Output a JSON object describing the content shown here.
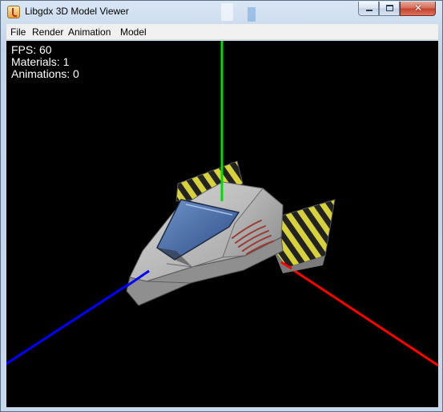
{
  "window": {
    "title": "Libgdx 3D Model Viewer",
    "controls": {
      "minimize": "minimize",
      "maximize": "maximize",
      "close": "✕"
    }
  },
  "menubar": {
    "items": [
      {
        "label": "File"
      },
      {
        "label": "Render"
      },
      {
        "label": "Animation"
      },
      {
        "label": "Model"
      }
    ]
  },
  "viewport": {
    "background": "#000000",
    "hud": {
      "fps": "FPS: 60",
      "materials": "Materials: 1",
      "animations": "Animations: 0"
    },
    "axes": {
      "x_color": "#ff0000",
      "y_color": "#00dd00",
      "z_color": "#0000ff"
    },
    "model": {
      "icon": "spaceship-model",
      "hull_color": "#b8b8b8",
      "canopy_color": "#3c5f9c",
      "stripe_colors": [
        "#d8d23a",
        "#222222"
      ],
      "scratch_color": "#9a3b33"
    }
  }
}
